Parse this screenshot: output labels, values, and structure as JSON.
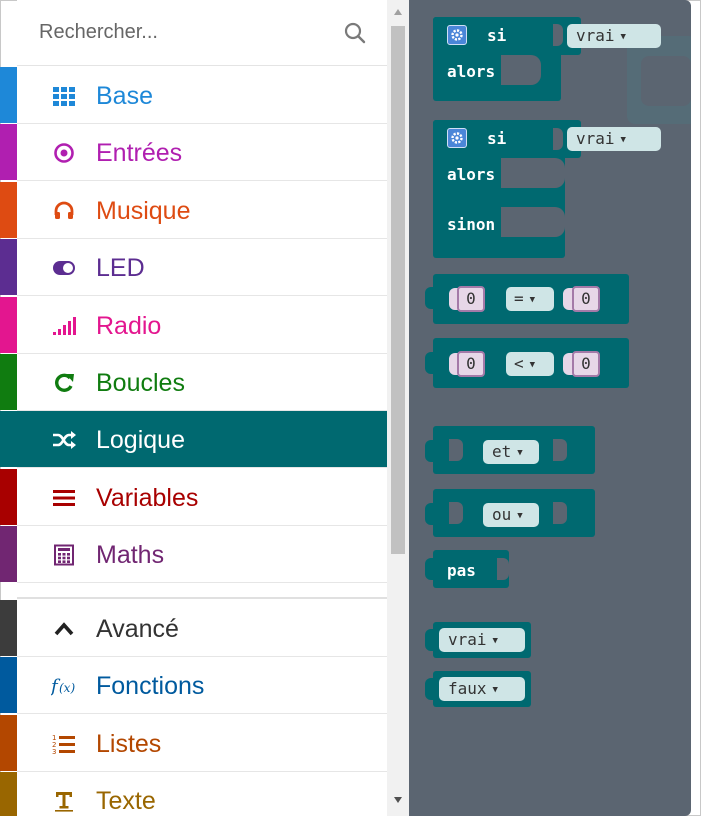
{
  "search": {
    "placeholder": "Rechercher...",
    "icon": "search-icon"
  },
  "categories": [
    {
      "label": "Base",
      "color": "#1e88d8",
      "icon": "grid-icon"
    },
    {
      "label": "Entrées",
      "color": "#b01fb0",
      "icon": "target-icon"
    },
    {
      "label": "Musique",
      "color": "#de4b12",
      "icon": "headphones-icon"
    },
    {
      "label": "LED",
      "color": "#5c2d91",
      "icon": "toggle-icon"
    },
    {
      "label": "Radio",
      "color": "#e3168f",
      "icon": "signal-bars-icon"
    },
    {
      "label": "Boucles",
      "color": "#107c10",
      "icon": "refresh-icon"
    },
    {
      "label": "Logique",
      "color": "#006970",
      "icon": "shuffle-icon",
      "selected": true
    },
    {
      "label": "Variables",
      "color": "#a80000",
      "icon": "lines-icon"
    },
    {
      "label": "Maths",
      "color": "#712672",
      "icon": "calculator-icon"
    }
  ],
  "advanced_categories": [
    {
      "label": "Avancé",
      "color": "#3c3c3c",
      "icon": "chevron-up-icon"
    },
    {
      "label": "Fonctions",
      "color": "#005a9e",
      "icon": "function-icon"
    },
    {
      "label": "Listes",
      "color": "#b34700",
      "icon": "numbered-list-icon"
    },
    {
      "label": "Texte",
      "color": "#996600",
      "icon": "text-icon"
    }
  ],
  "flyout": {
    "if_block": {
      "si": "si",
      "alors": "alors",
      "value": "vrai"
    },
    "if_else_block": {
      "si": "si",
      "alors": "alors",
      "sinon": "sinon",
      "value": "vrai"
    },
    "compare_eq": {
      "left": "0",
      "op": "=",
      "right": "0"
    },
    "compare_lt": {
      "left": "0",
      "op": "<",
      "right": "0"
    },
    "and_block": {
      "op": "et"
    },
    "or_block": {
      "op": "ou"
    },
    "not_block": {
      "label": "pas"
    },
    "true_block": {
      "label": "vrai"
    },
    "false_block": {
      "label": "faux"
    }
  },
  "colors": {
    "flyout_bg": "#5b6571",
    "logic_block": "#006970",
    "field": "#cfe5e6",
    "number_shadow": "#e7d7e8"
  }
}
